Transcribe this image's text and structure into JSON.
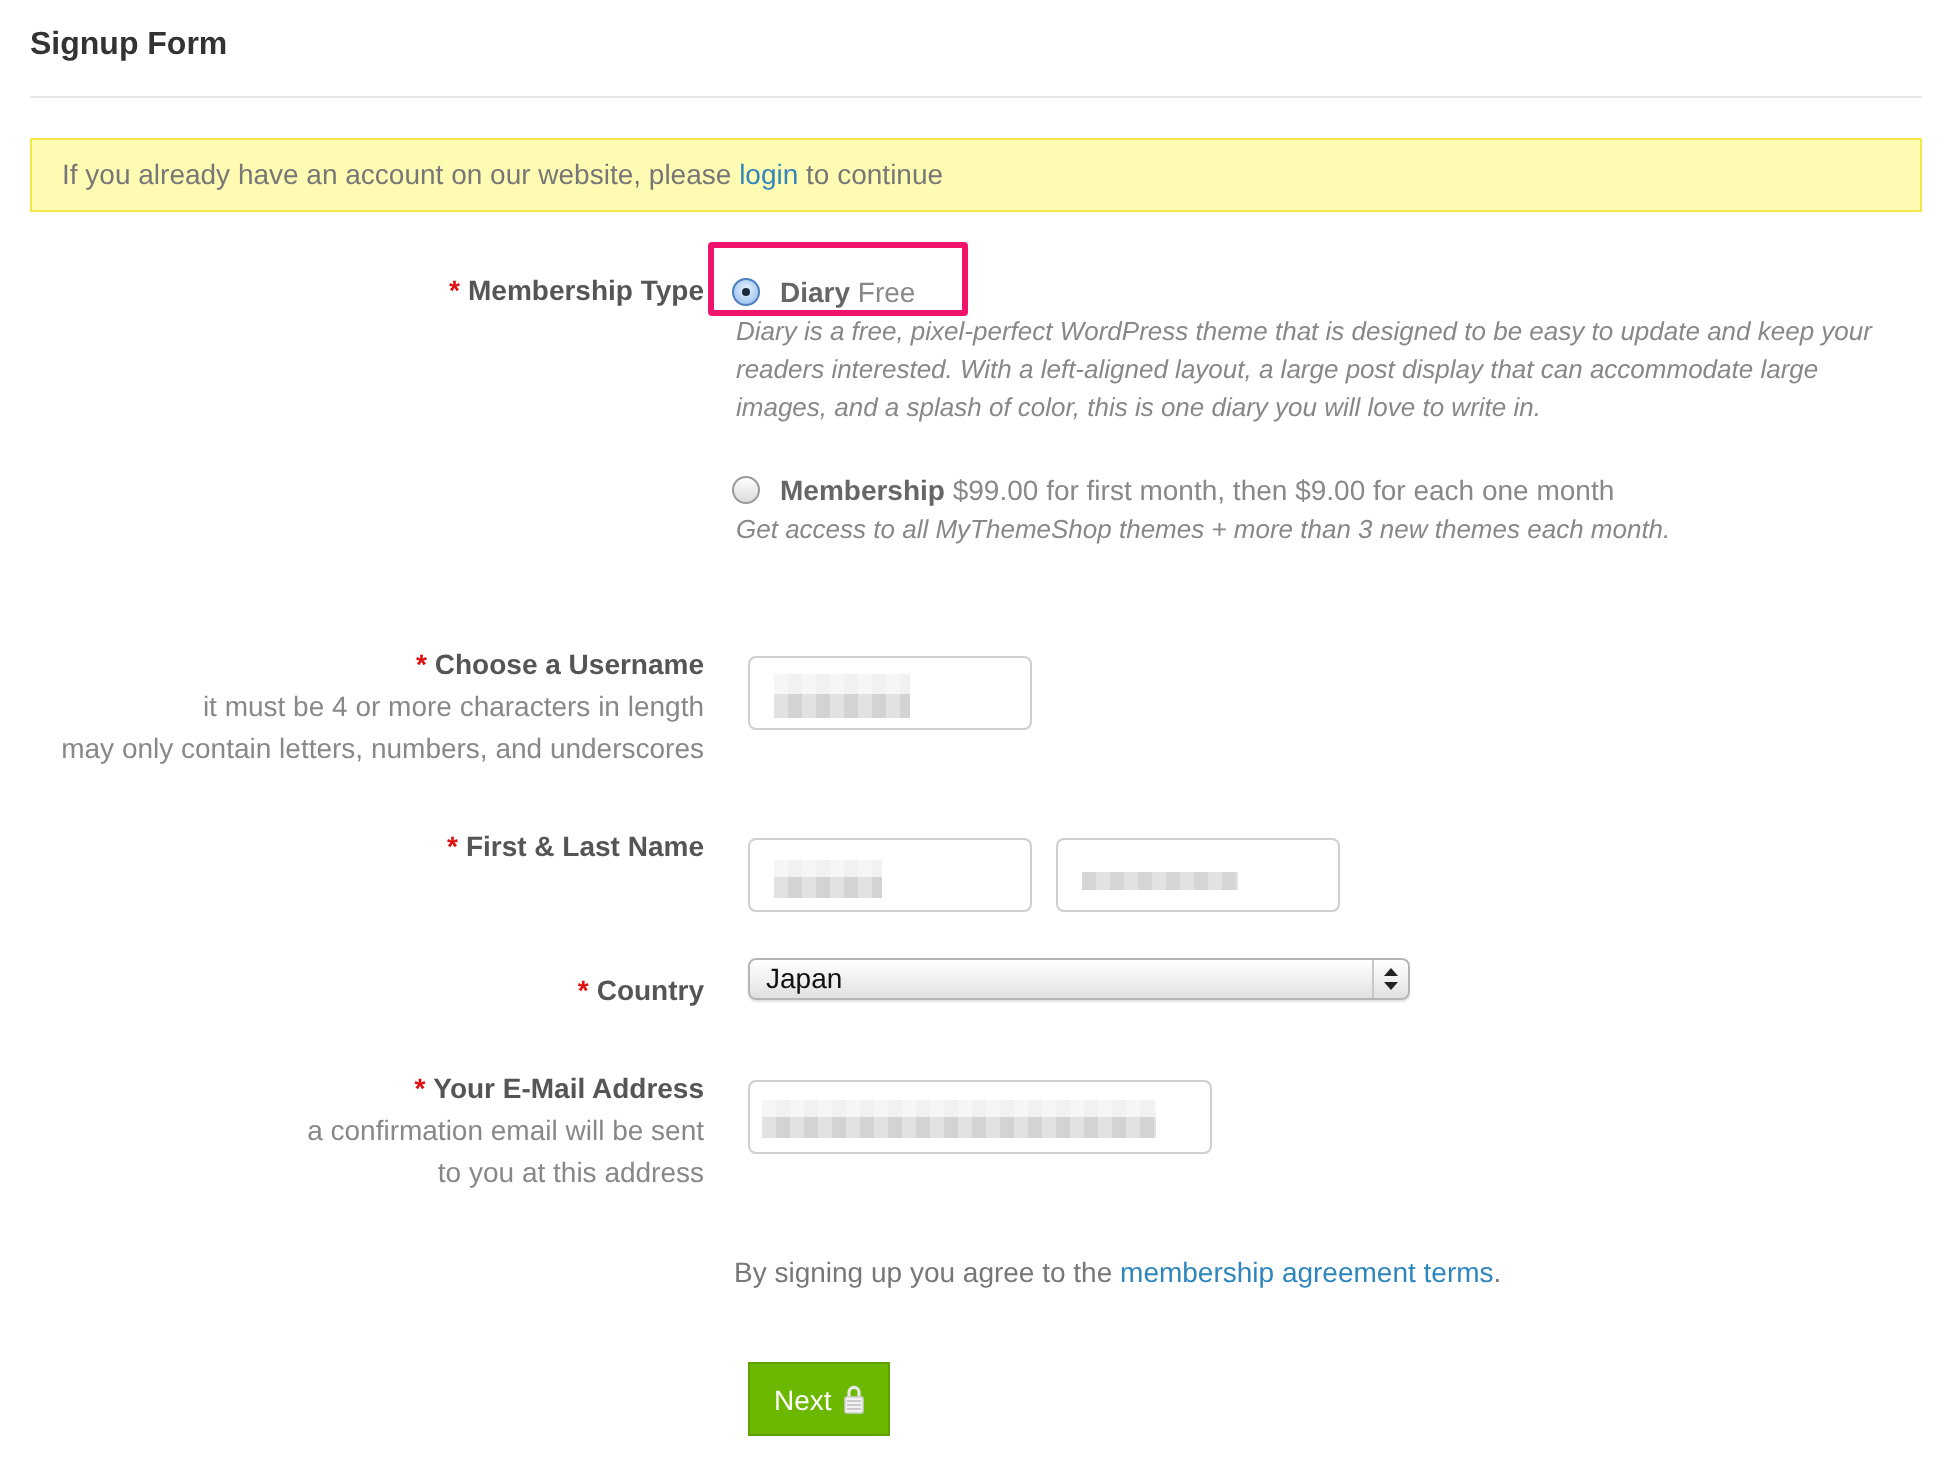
{
  "page": {
    "title": "Signup Form"
  },
  "notice": {
    "text": "If you already have an account on our website, please",
    "link": "login",
    "text_after": "to continue"
  },
  "membership": {
    "required_mark": "*",
    "label": "Membership Type",
    "options": [
      {
        "title": "**Diary** Free",
        "description": "Diary is a free, pixel-perfect WordPress theme that is designed to be easy to update and keep your readers interested. With a left-aligned layout, a large post display that can accommodate large images, and a splash of color, this is one diary you will love to write in.",
        "selected": true,
        "highlighted": true
      },
      {
        "title": "**Membership** $99.00 for first month, then $9.00 for each one month",
        "description": "Get access to all MyThemeShop themes + more than 3 new themes each month.",
        "selected": false,
        "highlighted": false
      }
    ]
  },
  "fields": [
    {
      "kind": "text",
      "required_mark": "*",
      "label": "Choose a Username",
      "hints": [
        "it must be 4 or more characters in length",
        "may only contain letters, numbers, and underscores"
      ],
      "inputs": [
        {
          "value_blurred": true
        }
      ]
    },
    {
      "kind": "name",
      "required_mark": "*",
      "label": "First & Last Name",
      "inputs": [
        {
          "value_blurred": true
        },
        {
          "value_blurred": true
        }
      ]
    },
    {
      "kind": "select",
      "required_mark": "*",
      "label": "Country",
      "value": "Japan"
    },
    {
      "kind": "email",
      "required_mark": "*",
      "label": "Your E-Mail Address",
      "hints": [
        "a confirmation email will be sent to you at this address"
      ],
      "inputs": [
        {
          "value_blurred": true
        }
      ]
    }
  ],
  "agreement": {
    "text": "By signing up you agree to the",
    "link": "membership agreement terms",
    "text_after": "."
  },
  "submit": {
    "label": "Next"
  }
}
